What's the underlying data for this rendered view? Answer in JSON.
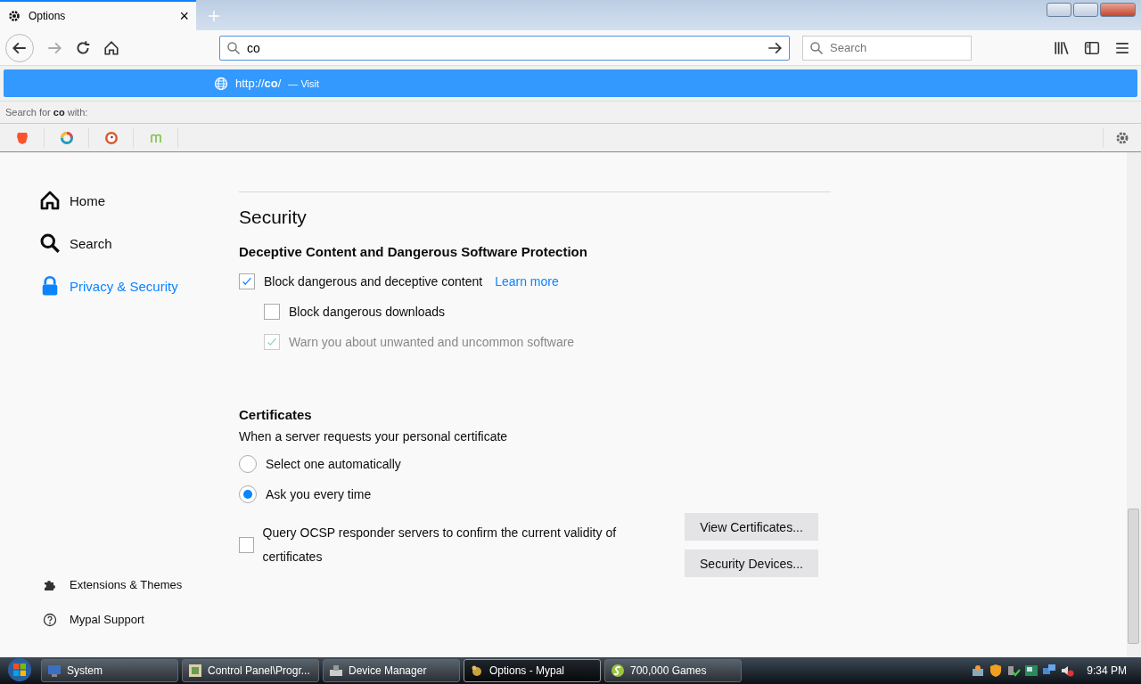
{
  "tab": {
    "title": "Options",
    "close": "×"
  },
  "toolbar": {
    "url_value": "co",
    "search_placeholder": "Search"
  },
  "url_popup": {
    "url": "http://**co**/",
    "action": "— Visit",
    "search_label": "Search for **co** with:"
  },
  "sidebar": {
    "items": [
      {
        "label": "Home",
        "kind": "home",
        "selected": false
      },
      {
        "label": "Search",
        "kind": "search",
        "selected": false
      },
      {
        "label": "Privacy & Security",
        "kind": "lock",
        "selected": true
      }
    ],
    "footer": [
      {
        "label": "Extensions & Themes",
        "kind": "puzzle"
      },
      {
        "label": "Mypal Support",
        "kind": "help"
      }
    ]
  },
  "security": {
    "title": "Security",
    "protection": {
      "heading": "Deceptive Content and Dangerous Software Protection",
      "learn_more": "Learn more",
      "option": {
        "label": "Block dangerous and deceptive content",
        "checked": true,
        "disabled": false,
        "children": [
          {
            "label": "Block dangerous downloads",
            "checked": false,
            "disabled": false
          },
          {
            "label": "Warn you about unwanted and uncommon software",
            "checked": true,
            "disabled": true
          }
        ]
      }
    },
    "certificates": {
      "heading": "Certificates",
      "description": "When a server requests your personal certificate",
      "radios": [
        {
          "label": "Select one automatically",
          "selected": false
        },
        {
          "label": "Ask you every time",
          "selected": true
        }
      ],
      "ocsp": {
        "label": "Query OCSP responder servers to confirm the current validity of certificates",
        "checked": false
      },
      "buttons": [
        "View Certificates...",
        "Security Devices..."
      ]
    }
  },
  "taskbar": {
    "items": [
      {
        "label": "System",
        "selected": false
      },
      {
        "label": "Control Panel\\Progr...",
        "selected": false
      },
      {
        "label": "Device Manager",
        "selected": false
      },
      {
        "label": "Options - Mypal",
        "selected": true
      },
      {
        "label": "700,000 Games",
        "selected": false
      }
    ],
    "clock": "9:34 PM"
  }
}
